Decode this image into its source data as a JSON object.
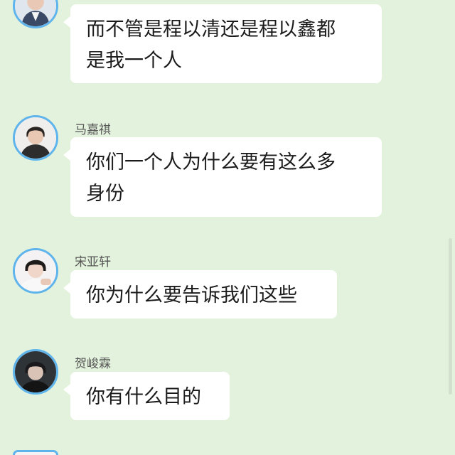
{
  "messages": [
    {
      "sender": "",
      "lines": [
        "而不管是程以清还是程以鑫都",
        "是我一个人"
      ],
      "avatar_icon": "user-avatar-icon"
    },
    {
      "sender": "马嘉祺",
      "lines": [
        "你们一个人为什么要有这么多",
        "身份"
      ],
      "avatar_icon": "user-avatar-icon"
    },
    {
      "sender": "宋亚轩",
      "lines": [
        "你为什么要告诉我们这些"
      ],
      "avatar_icon": "user-avatar-icon"
    },
    {
      "sender": "贺峻霖",
      "lines": [
        "你有什么目的"
      ],
      "avatar_icon": "user-avatar-icon"
    }
  ],
  "colors": {
    "background": "#e3f2dc",
    "bubble": "#ffffff",
    "avatar_ring": "#5fb4ec"
  }
}
